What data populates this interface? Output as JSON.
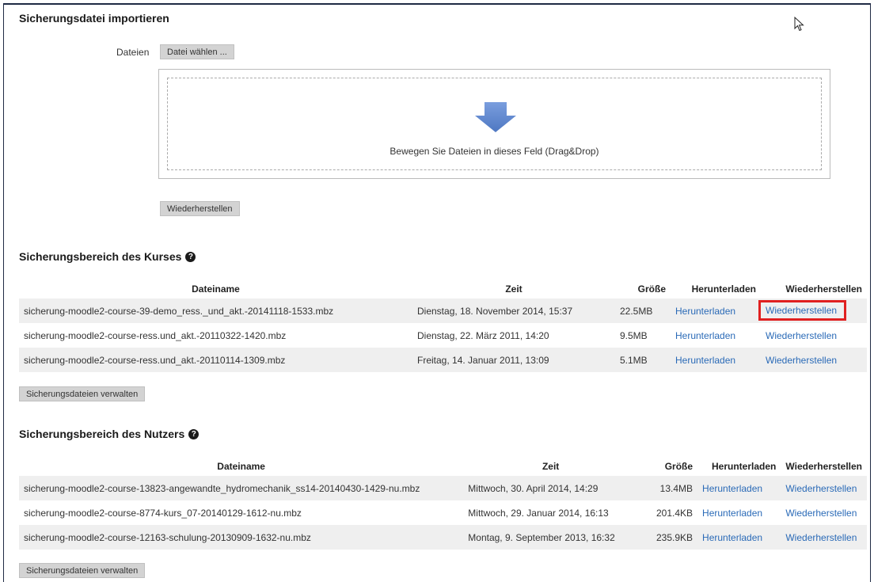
{
  "import": {
    "title": "Sicherungsdatei importieren",
    "files_label": "Dateien",
    "choose_file_button": "Datei wählen ...",
    "dropzone_text": "Bewegen Sie Dateien in dieses Feld (Drag&Drop)",
    "restore_button": "Wiederherstellen"
  },
  "course_area": {
    "title": "Sicherungsbereich des Kurses",
    "help_icon": "question-circle-icon",
    "columns": [
      "Dateiname",
      "Zeit",
      "Größe",
      "Herunterladen",
      "Wiederherstellen"
    ],
    "rows": [
      {
        "name": "sicherung-moodle2-course-39-demo_ress._und_akt.-20141118-1533.mbz",
        "time": "Dienstag, 18. November 2014, 15:37",
        "size": "22.5MB",
        "download": "Herunterladen",
        "restore": "Wiederherstellen",
        "highlighted": true
      },
      {
        "name": "sicherung-moodle2-course-ress.und_akt.-20110322-1420.mbz",
        "time": "Dienstag, 22. März 2011, 14:20",
        "size": "9.5MB",
        "download": "Herunterladen",
        "restore": "Wiederherstellen"
      },
      {
        "name": "sicherung-moodle2-course-ress.und_akt.-20110114-1309.mbz",
        "time": "Freitag, 14. Januar 2011, 13:09",
        "size": "5.1MB",
        "download": "Herunterladen",
        "restore": "Wiederherstellen"
      }
    ],
    "manage_button": "Sicherungsdateien verwalten"
  },
  "user_area": {
    "title": "Sicherungsbereich des Nutzers",
    "help_icon": "question-circle-icon",
    "columns": [
      "Dateiname",
      "Zeit",
      "Größe",
      "Herunterladen",
      "Wiederherstellen"
    ],
    "rows": [
      {
        "name": "sicherung-moodle2-course-13823-angewandte_hydromechanik_ss14-20140430-1429-nu.mbz",
        "time": "Mittwoch, 30. April 2014, 14:29",
        "size": "13.4MB",
        "download": "Herunterladen",
        "restore": "Wiederherstellen"
      },
      {
        "name": "sicherung-moodle2-course-8774-kurs_07-20140129-1612-nu.mbz",
        "time": "Mittwoch, 29. Januar 2014, 16:13",
        "size": "201.4KB",
        "download": "Herunterladen",
        "restore": "Wiederherstellen"
      },
      {
        "name": "sicherung-moodle2-course-12163-schulung-20130909-1632-nu.mbz",
        "time": "Montag, 9. September 2013, 16:32",
        "size": "235.9KB",
        "download": "Herunterladen",
        "restore": "Wiederherstellen"
      }
    ],
    "manage_button": "Sicherungsdateien verwalten"
  },
  "colors": {
    "link": "#2a6ab7",
    "highlight": "#e02020",
    "row_stripe": "#efefef",
    "arrow": "#5b84c9"
  }
}
